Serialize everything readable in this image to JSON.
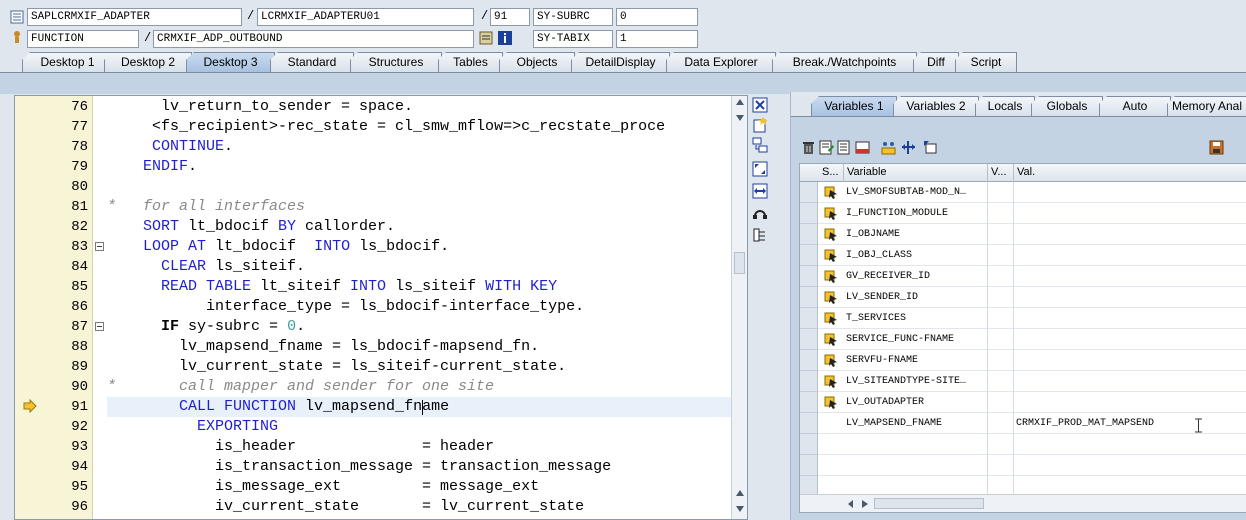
{
  "header": {
    "row1": {
      "program": "SAPLCRMXIF_ADAPTER",
      "include": "LCRMXIF_ADAPTERU01",
      "line": "91",
      "sysvar_label": "SY-SUBRC",
      "sysvar_value": "0"
    },
    "row2": {
      "type": "FUNCTION",
      "name": "CRMXIF_ADP_OUTBOUND",
      "sysvar_label": "SY-TABIX",
      "sysvar_value": "1"
    },
    "separator": "/"
  },
  "tabs": [
    "Desktop 1",
    "Desktop 2",
    "Desktop 3",
    "Standard",
    "Structures",
    "Tables",
    "Objects",
    "DetailDisplay",
    "Data Explorer",
    "Break./Watchpoints",
    "Diff",
    "Script"
  ],
  "active_tab": "Desktop 3",
  "editor": {
    "current_line": "91",
    "lines": [
      {
        "n": "76",
        "t": [
          [
            "",
            "      lv_return_to_sender = space."
          ]
        ]
      },
      {
        "n": "77",
        "t": [
          [
            "",
            "     <fs_recipient>-rec_state = cl_smw_mflow=>c_recstate_proce"
          ]
        ]
      },
      {
        "n": "78",
        "t": [
          [
            "kw",
            "     CONTINUE"
          ],
          [
            "",
            "."
          ]
        ]
      },
      {
        "n": "79",
        "t": [
          [
            "kw",
            "    ENDIF"
          ],
          [
            "",
            "."
          ]
        ]
      },
      {
        "n": "80",
        "t": [
          [
            "",
            ""
          ]
        ]
      },
      {
        "n": "81",
        "t": [
          [
            "cm",
            "*   for all interfaces"
          ]
        ]
      },
      {
        "n": "82",
        "t": [
          [
            "kw",
            "    SORT "
          ],
          [
            "",
            "lt_bdocif "
          ],
          [
            "kw",
            "BY "
          ],
          [
            "",
            "callorder."
          ]
        ]
      },
      {
        "n": "83",
        "t": [
          [
            "kw",
            "    LOOP AT "
          ],
          [
            "",
            "lt_bdocif  "
          ],
          [
            "kw",
            "INTO "
          ],
          [
            "",
            "ls_bdocif."
          ]
        ]
      },
      {
        "n": "84",
        "t": [
          [
            "kw",
            "      CLEAR "
          ],
          [
            "",
            "ls_siteif."
          ]
        ]
      },
      {
        "n": "85",
        "t": [
          [
            "kw",
            "      READ TABLE "
          ],
          [
            "",
            "lt_siteif "
          ],
          [
            "kw",
            "INTO "
          ],
          [
            "",
            "ls_siteif "
          ],
          [
            "kw",
            "WITH KEY"
          ]
        ]
      },
      {
        "n": "86",
        "t": [
          [
            "",
            "           interface_type = ls_bdocif-interface_type."
          ]
        ]
      },
      {
        "n": "87",
        "t": [
          [
            "",
            "      "
          ],
          [
            "b",
            "IF"
          ],
          [
            "",
            " sy-subrc = "
          ],
          [
            "num",
            "0"
          ],
          [
            "",
            "."
          ]
        ]
      },
      {
        "n": "88",
        "t": [
          [
            "",
            "        lv_mapsend_fname = ls_bdocif-mapsend_fn."
          ]
        ]
      },
      {
        "n": "89",
        "t": [
          [
            "",
            "        lv_current_state = ls_siteif-current_state."
          ]
        ]
      },
      {
        "n": "90",
        "t": [
          [
            "cm",
            "*       call mapper and sender for one site"
          ]
        ]
      },
      {
        "n": "91",
        "t": [
          [
            "kw",
            "        CALL FUNCTION "
          ],
          [
            "",
            "lv_mapsend_fname"
          ]
        ]
      },
      {
        "n": "92",
        "t": [
          [
            "kw",
            "          EXPORTING"
          ]
        ]
      },
      {
        "n": "93",
        "t": [
          [
            "",
            "            is_header              = header"
          ]
        ]
      },
      {
        "n": "94",
        "t": [
          [
            "",
            "            is_transaction_message = transaction_message"
          ]
        ]
      },
      {
        "n": "95",
        "t": [
          [
            "",
            "            is_message_ext         = message_ext"
          ]
        ]
      },
      {
        "n": "96",
        "t": [
          [
            "",
            "            iv_current_state       = lv_current_state"
          ]
        ]
      }
    ]
  },
  "right_tabs": [
    "Variables 1",
    "Variables 2",
    "Locals",
    "Globals",
    "Auto",
    "Memory Anal"
  ],
  "active_right_tab": "Variables 1",
  "grid": {
    "headers": {
      "s": "S...",
      "variable": "Variable",
      "v": "V...",
      "val": "Val."
    },
    "rows": [
      {
        "name": "LV_SMOFSUBTAB-MOD_N…",
        "value": "",
        "icon": true
      },
      {
        "name": "I_FUNCTION_MODULE",
        "value": "",
        "icon": true
      },
      {
        "name": "I_OBJNAME",
        "value": "",
        "icon": true
      },
      {
        "name": "I_OBJ_CLASS",
        "value": "",
        "icon": true
      },
      {
        "name": "GV_RECEIVER_ID",
        "value": "",
        "icon": true
      },
      {
        "name": "LV_SENDER_ID",
        "value": "",
        "icon": true
      },
      {
        "name": "T_SERVICES",
        "value": "",
        "icon": true
      },
      {
        "name": "SERVICE_FUNC-FNAME",
        "value": "",
        "icon": true
      },
      {
        "name": "SERVFU-FNAME",
        "value": "",
        "icon": true
      },
      {
        "name": "LV_SITEANDTYPE-SITE…",
        "value": "",
        "icon": true
      },
      {
        "name": "LV_OUTADAPTER",
        "value": "",
        "icon": true
      },
      {
        "name": "LV_MAPSEND_FNAME",
        "value": "CRMXIF_PROD_MAT_MAPSEND",
        "icon": false
      },
      {
        "name": "",
        "value": "",
        "icon": false
      },
      {
        "name": "",
        "value": "",
        "icon": false
      },
      {
        "name": "",
        "value": "",
        "icon": false
      }
    ]
  },
  "colors": {
    "keyword": "#1f1fd0",
    "comment": "#8a8a8a",
    "number": "#3a9f9f",
    "gutter": "#f8f4d6",
    "tab_active": "#a9c2e2"
  }
}
